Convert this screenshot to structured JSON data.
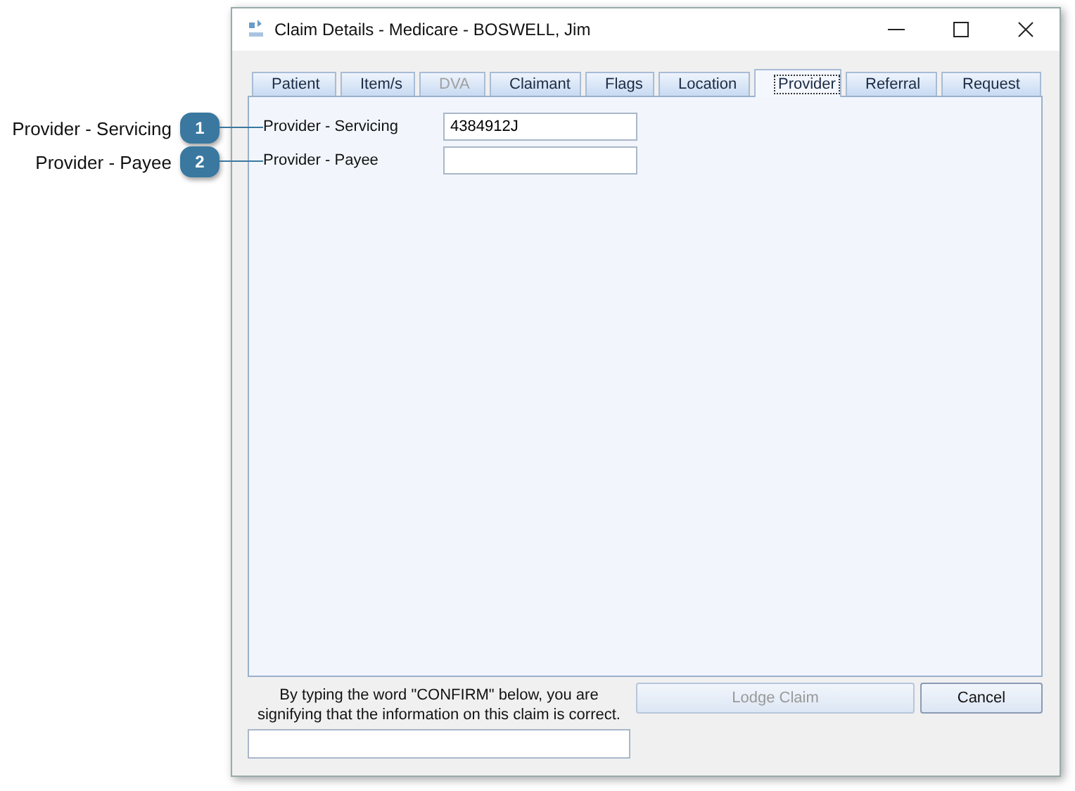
{
  "callouts": [
    {
      "number": "1",
      "label": "Provider - Servicing"
    },
    {
      "number": "2",
      "label": "Provider - Payee"
    }
  ],
  "window": {
    "title": "Claim Details - Medicare - BOSWELL, Jim"
  },
  "tabs": [
    {
      "label": "Patient",
      "selected": false,
      "disabled": false
    },
    {
      "label": "Item/s",
      "selected": false,
      "disabled": false
    },
    {
      "label": "DVA",
      "selected": false,
      "disabled": true
    },
    {
      "label": "Claimant",
      "selected": false,
      "disabled": false
    },
    {
      "label": "Flags",
      "selected": false,
      "disabled": false
    },
    {
      "label": "Location",
      "selected": false,
      "disabled": false
    },
    {
      "label": "Provider",
      "selected": true,
      "disabled": false
    },
    {
      "label": "Referral",
      "selected": false,
      "disabled": false
    },
    {
      "label": "Request",
      "selected": false,
      "disabled": false
    }
  ],
  "fields": [
    {
      "label": "Provider - Servicing",
      "value": "4384912J"
    },
    {
      "label": "Provider - Payee"
    }
  ],
  "confirm": {
    "text": "By typing the word \"CONFIRM\" below, you are signifying that the information on this claim is correct."
  },
  "buttons": [
    {
      "label": "Lodge Claim",
      "disabled": true
    },
    {
      "label": "Cancel",
      "disabled": false
    }
  ]
}
